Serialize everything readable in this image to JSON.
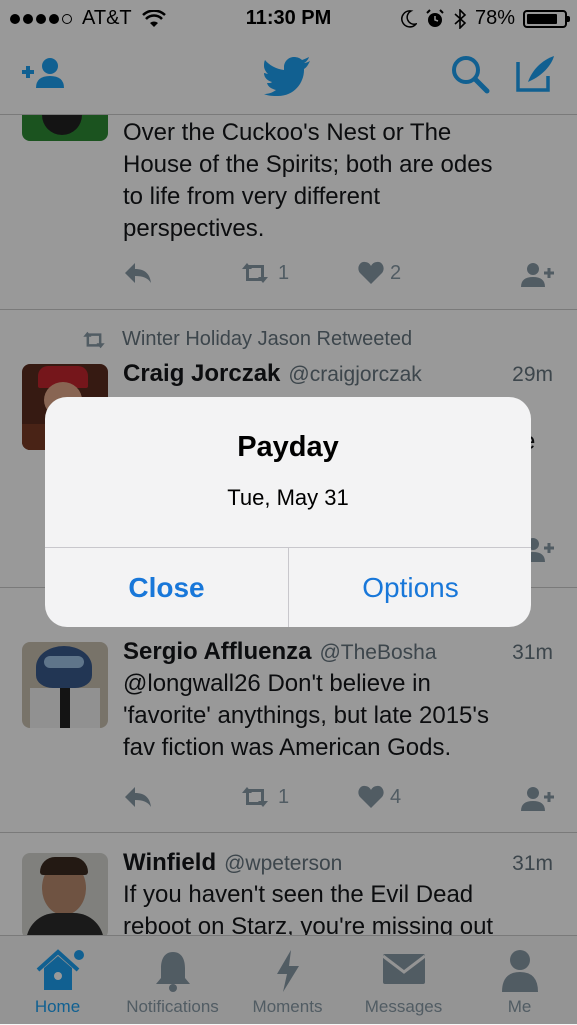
{
  "status_bar": {
    "carrier": "AT&T",
    "time": "11:30 PM",
    "battery": "78%"
  },
  "nav": {
    "add_user_icon": "add-user-icon",
    "logo_icon": "twitter-bird-icon",
    "search_icon": "search-icon",
    "compose_icon": "compose-icon"
  },
  "tweets": [
    {
      "text_lines": [
        "Over the Cuckoo's Nest or The",
        "House of the Spirits; both are odes",
        "to life from very different",
        "perspectives."
      ],
      "retweets": "1",
      "likes": "2"
    },
    {
      "retweet_context": "Winter Holiday Jason Retweeted",
      "name": "Craig Jorczak",
      "handle": "@craigjorczak",
      "time": "29m",
      "partial_char": "e"
    },
    {
      "name": "Sergio Affluenza",
      "handle": "@TheBosha",
      "time": "31m",
      "text_lines": [
        "@longwall26 Don't believe in",
        "'favorite' anythings, but late 2015's",
        "fav fiction was American Gods."
      ],
      "retweets": "1",
      "likes": "4"
    },
    {
      "name": "Winfield",
      "handle": "@wpeterson",
      "time": "31m",
      "text_lines": [
        "If you haven't seen the Evil Dead",
        "reboot on Starz, you're missing out"
      ]
    }
  ],
  "tabs": [
    {
      "label": "Home",
      "active": true
    },
    {
      "label": "Notifications"
    },
    {
      "label": "Moments"
    },
    {
      "label": "Messages"
    },
    {
      "label": "Me"
    }
  ],
  "alert": {
    "title": "Payday",
    "message": "Tue, May 31",
    "close_label": "Close",
    "options_label": "Options"
  },
  "colors": {
    "accent": "#1da1f2",
    "alert_button": "#1877d9",
    "secondary_text": "#66757f"
  }
}
